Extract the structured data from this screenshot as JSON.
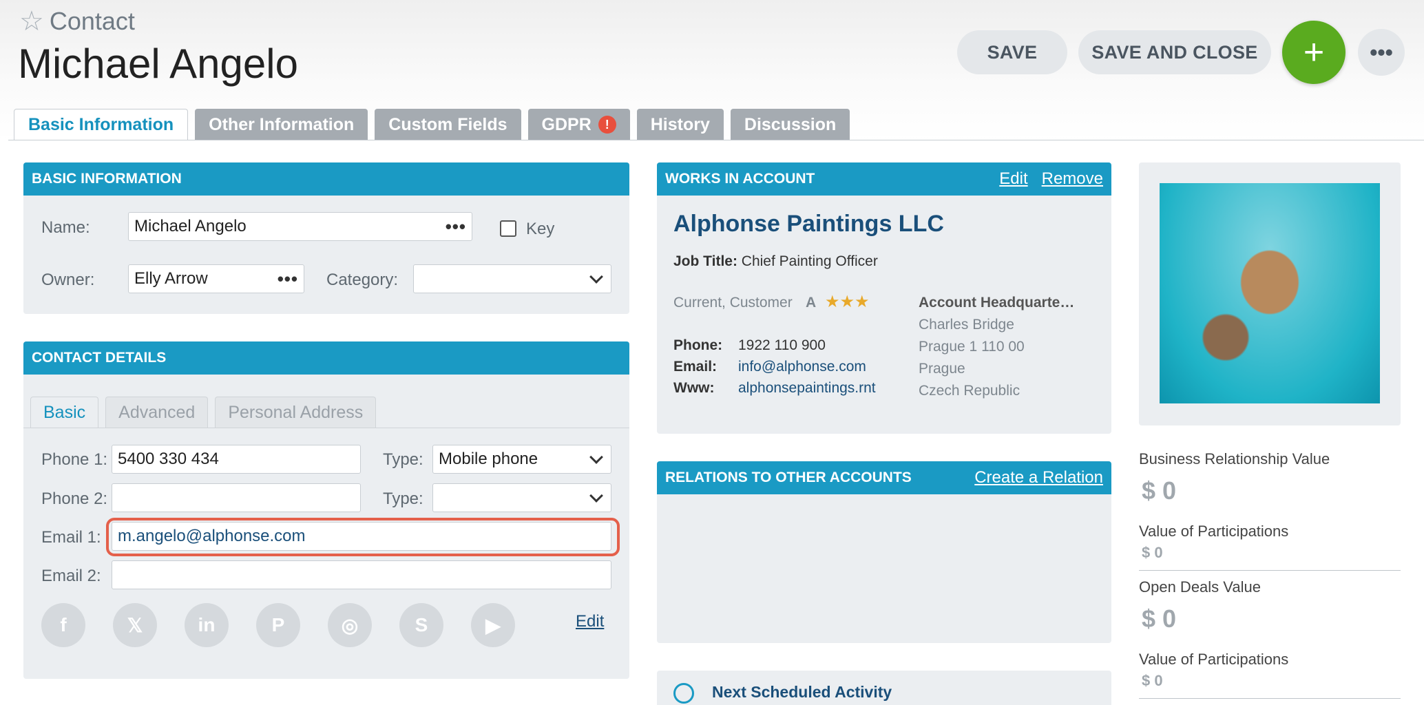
{
  "header": {
    "entity_type": "Contact",
    "title": "Michael Angelo",
    "save_label": "SAVE",
    "save_close_label": "SAVE AND CLOSE",
    "add_label": "+",
    "more_label": "•••"
  },
  "tabs": [
    {
      "label": "Basic Information"
    },
    {
      "label": "Other Information"
    },
    {
      "label": "Custom Fields"
    },
    {
      "label": "GDPR",
      "badge": "!"
    },
    {
      "label": "History"
    },
    {
      "label": "Discussion"
    }
  ],
  "basic_info": {
    "header": "BASIC INFORMATION",
    "name_label": "Name:",
    "name_value": "Michael Angelo",
    "key_label": "Key",
    "owner_label": "Owner:",
    "owner_value": "Elly Arrow",
    "category_label": "Category:",
    "category_value": ""
  },
  "contact_details": {
    "header": "CONTACT DETAILS",
    "subtabs": [
      "Basic",
      "Advanced",
      "Personal Address"
    ],
    "phone1_label": "Phone 1:",
    "phone1_value": "5400 330 434",
    "type_label": "Type:",
    "phone1_type": "Mobile phone",
    "phone2_label": "Phone 2:",
    "phone2_value": "",
    "phone2_type": "",
    "email1_label": "Email 1:",
    "email1_value": "m.angelo@alphonse.com",
    "email2_label": "Email 2:",
    "email2_value": "",
    "edit_label": "Edit"
  },
  "account": {
    "header": "WORKS IN ACCOUNT",
    "edit_label": "Edit",
    "remove_label": "Remove",
    "name": "Alphonse Paintings LLC",
    "job_title_label": "Job Title:",
    "job_title": "Chief Painting Officer",
    "status": "Current, Customer",
    "rating_letter": "A",
    "stars": "★★★",
    "phone_label": "Phone:",
    "phone": "1922 110 900",
    "email_label": "Email:",
    "email": "info@alphonse.com",
    "www_label": "Www:",
    "www": "alphonsepaintings.rnt",
    "hq_label": "Account Headquarte…",
    "hq_line1": "Charles Bridge",
    "hq_line2": "Prague 1 110 00",
    "hq_line3": "Prague",
    "hq_line4": "Czech Republic"
  },
  "relations": {
    "header": "RELATIONS TO OTHER ACCOUNTS",
    "create_label": "Create a Relation"
  },
  "activity": {
    "label": "Next Scheduled Activity"
  },
  "stats": {
    "brv_label": "Business Relationship Value",
    "brv_value": "$ 0",
    "vop1_label": "Value of Participations",
    "vop1_value": "$ 0",
    "odv_label": "Open Deals Value",
    "odv_value": "$ 0",
    "vop2_label": "Value of Participations",
    "vop2_value": "$ 0"
  },
  "colors": {
    "accent": "#1a9ac4",
    "add_button": "#5aab1f",
    "highlight": "#e4604b",
    "link": "#1a4f7a"
  }
}
